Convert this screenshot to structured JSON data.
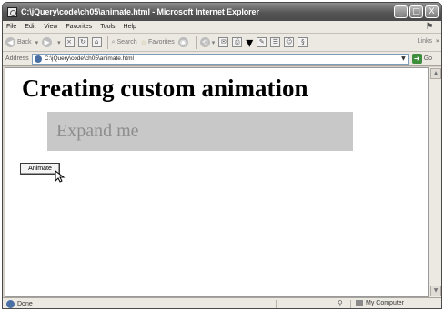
{
  "window": {
    "title": "C:\\jQuery\\code\\ch05\\animate.html - Microsoft Internet Explorer",
    "buttons": {
      "minimize": "_",
      "maximize": "□",
      "close": "X"
    }
  },
  "menubar": {
    "items": [
      "File",
      "Edit",
      "View",
      "Favorites",
      "Tools",
      "Help"
    ]
  },
  "toolbar": {
    "back": "Back",
    "search": "Search",
    "favorites": "Favorites",
    "links": "Links"
  },
  "addressbar": {
    "label": "Address",
    "url": "C:\\jQuery\\code\\ch05\\animate.html",
    "go": "Go"
  },
  "page": {
    "heading": "Creating custom animation",
    "expand_text": "Expand me",
    "button_label": "Animate"
  },
  "statusbar": {
    "status": "Done",
    "zone": "My Computer"
  }
}
